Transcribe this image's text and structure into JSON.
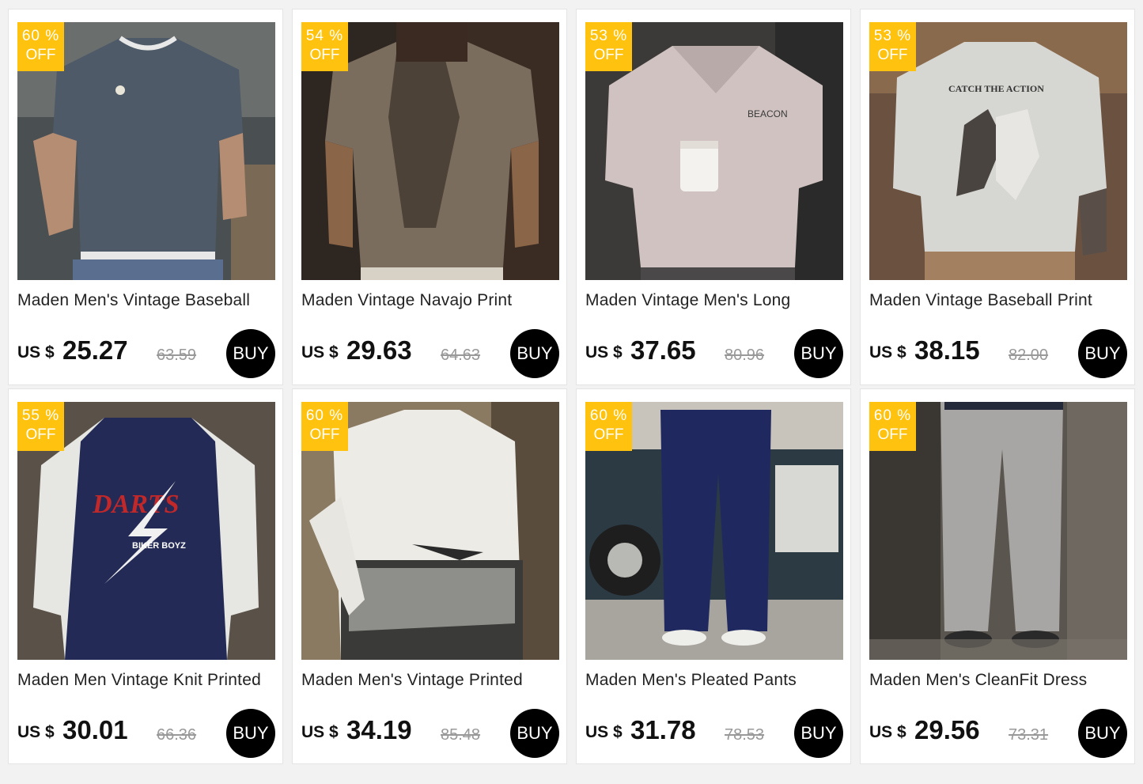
{
  "currency_label": "US $",
  "buy_label": "BUY",
  "off_label": "OFF",
  "products": [
    {
      "discount": "60 %",
      "title": "Maden Men's Vintage Baseball",
      "price": "25.27",
      "old_price": "63.59",
      "image": "navy henley t-shirt"
    },
    {
      "discount": "54 %",
      "title": "Maden Vintage Navajo Print",
      "price": "29.63",
      "old_price": "64.63",
      "image": "brown printed t-shirt"
    },
    {
      "discount": "53 %",
      "title": "Maden Vintage Men's Long",
      "price": "37.65",
      "old_price": "80.96",
      "image": "light pink polo sweatshirt"
    },
    {
      "discount": "53 %",
      "title": "Maden Vintage Baseball Print",
      "price": "38.15",
      "old_price": "82.00",
      "image": "grey baseball print sweatshirt"
    },
    {
      "discount": "55 %",
      "title": "Maden Men Vintage Knit Printed",
      "price": "30.01",
      "old_price": "66.36",
      "image": "navy raglan darts tee"
    },
    {
      "discount": "60 %",
      "title": "Maden Men's Vintage Printed",
      "price": "34.19",
      "old_price": "85.48",
      "image": "white printed shirt back"
    },
    {
      "discount": "60 %",
      "title": "Maden Men's Pleated Pants",
      "price": "31.78",
      "old_price": "78.53",
      "image": "navy pleated pants"
    },
    {
      "discount": "60 %",
      "title": "Maden Men's CleanFit Dress",
      "price": "29.56",
      "old_price": "73.31",
      "image": "grey dress pants"
    }
  ],
  "colors": {
    "badge": "#ffc20e",
    "buy_button": "#000000",
    "page_background": "#f2f2f2"
  }
}
